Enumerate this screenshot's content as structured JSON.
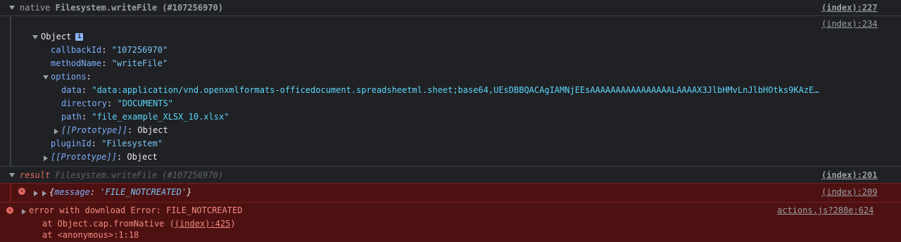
{
  "group_native": {
    "prefix": "native",
    "call": "Filesystem.writeFile (#107256970)",
    "source": "(index):227"
  },
  "object_log": {
    "source": "(index):234",
    "title": "Object",
    "info_badge": "i",
    "props": [
      {
        "key": "callbackId",
        "value": "\"107256970\""
      },
      {
        "key": "methodName",
        "value": "\"writeFile\""
      }
    ],
    "options": {
      "key": "options",
      "data_key": "data",
      "data_value": "\"data:application/vnd.openxmlformats-officedocument.spreadsheetml.sheet;base64,UEsDBBQACAgIAMNjEEsAAAAAAAAAAAAAAAALAAAAX3JlbHMvLnJlbHOtks9KAzE…",
      "directory_key": "directory",
      "directory_value": "\"DOCUMENTS\"",
      "path_key": "path",
      "path_value": "\"file_example_XLSX_10.xlsx\"",
      "proto_key": "[[Prototype]]",
      "proto_value": "Object"
    },
    "plugin_key": "pluginId",
    "plugin_value": "\"Filesystem\"",
    "proto_key": "[[Prototype]]",
    "proto_value": "Object"
  },
  "group_result": {
    "prefix": "result",
    "call": "Filesystem.writeFile (#107256970)",
    "source": "(index):201"
  },
  "result_error": {
    "text_open": "{",
    "key": "message",
    "value": "'FILE_NOTCREATED'",
    "text_close": "}",
    "source": "(index):209"
  },
  "download_error": {
    "message": "error with download Error: FILE_NOTCREATED",
    "stack_line1_prefix": "at Object.cap.fromNative (",
    "stack_line1_link": "(index):425",
    "stack_line1_suffix": ")",
    "stack_line2": "at <anonymous>:1:18",
    "source": "actions.js?288e:624"
  }
}
